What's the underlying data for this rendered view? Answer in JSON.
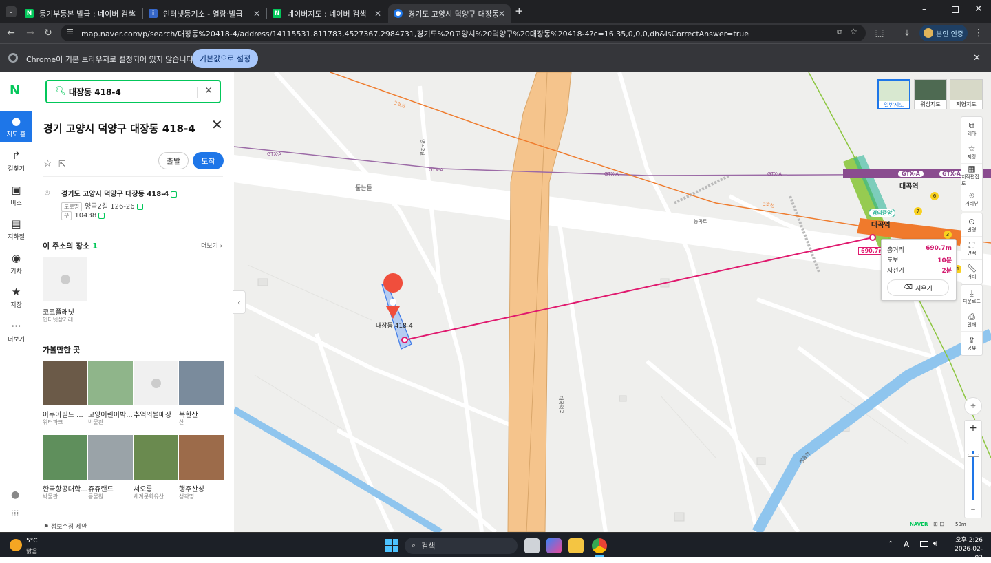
{
  "browser": {
    "tabs": [
      {
        "title": "등기부등본 발급 : 네이버 검색",
        "icon_color": "#03c75a",
        "icon_char": "N"
      },
      {
        "title": "인터넷등기소 - 열람·발급",
        "icon_color": "#3566c8",
        "icon_char": "i"
      },
      {
        "title": "네이버지도 : 네이버 검색",
        "icon_color": "#03c75a",
        "icon_char": "N"
      },
      {
        "title": "경기도 고양시 덕양구 대장동 4",
        "icon_color": "#1e76e8",
        "icon_char": "●"
      }
    ],
    "url": "map.naver.com/p/search/대장동%20418-4/address/14115531.811783,4527367.2984731,경기도%20고양시%20덕양구%20대장동%20418-4?c=16.35,0,0,0,dh&isCorrectAnswer=true",
    "profile_label": "본인 인증",
    "infobar_text": "Chrome이 기본 브라우저로 설정되어 있지 않습니다",
    "infobar_button": "기본값으로 설정"
  },
  "rail": {
    "logo": "N",
    "items": [
      {
        "label": "지도 홈",
        "icon": "map-pin-icon",
        "glyph": "●"
      },
      {
        "label": "길찾기",
        "icon": "route-icon",
        "glyph": "↱"
      },
      {
        "label": "버스",
        "icon": "bus-icon",
        "glyph": "▣"
      },
      {
        "label": "지하철",
        "icon": "subway-icon",
        "glyph": "▤"
      },
      {
        "label": "기차",
        "icon": "train-icon",
        "glyph": "◉"
      },
      {
        "label": "저장",
        "icon": "star-icon",
        "glyph": "★"
      },
      {
        "label": "더보기",
        "icon": "more-icon",
        "glyph": "···"
      }
    ]
  },
  "panel": {
    "search_value": "대장동 418-4",
    "title": "경기 고양시 덕양구 대장동 418-4",
    "depart_label": "출발",
    "arrive_label": "도착",
    "address": "경기도 고양시 덕양구 대장동 418-4",
    "road_tag": "도로명",
    "road_address": "양곡2길 126-26",
    "zip_tag": "우",
    "zip": "10438",
    "places_title": "이 주소의 장소",
    "places_count": "1",
    "more_label": "더보기",
    "place": {
      "name": "코코플래닛",
      "category": "인터넷상거래"
    },
    "nearby_title": "가볼만한 곳",
    "nearby": [
      {
        "name": "아쿠아필드 ...",
        "category": "워터파크",
        "color": "#6b5a48"
      },
      {
        "name": "고양어린이박...",
        "category": "박물관",
        "color": "#8fb58a"
      },
      {
        "name": "추억의썰매장",
        "category": "",
        "color": "#f0f0f0"
      },
      {
        "name": "북한산",
        "category": "산",
        "color": "#7a8b9c"
      },
      {
        "name": "한국항공대학...",
        "category": "박물관",
        "color": "#5f8f5c"
      },
      {
        "name": "쥬쥬랜드",
        "category": "동물원",
        "color": "#9aa3a8"
      },
      {
        "name": "서오릉",
        "category": "세계문화유산",
        "color": "#6a8a4f"
      },
      {
        "name": "행주산성",
        "category": "성곽명",
        "color": "#9c6b4a"
      }
    ],
    "edit_suggest": "정보수정 제안"
  },
  "map": {
    "labels": {
      "place": "풀는들",
      "pin": "대장동 418-4",
      "gtx": "GTX-A",
      "line3": "3호선",
      "station": "대곡역",
      "gyeongui": "경의중앙",
      "road1": "양곡2길",
      "road2": "능곡로",
      "road3": "대곡역로",
      "road4": "창릉천"
    },
    "map_types": [
      "일반지도",
      "위성지도",
      "지형지도"
    ],
    "controls": [
      "테마",
      "저장",
      "지적편집도",
      "거리뷰",
      "반경",
      "면적",
      "거리",
      "다운로드",
      "인쇄",
      "공유"
    ],
    "distance_popup": {
      "total_label": "총거리",
      "total_value": "690.7m",
      "walk_label": "도보",
      "walk_value": "10분",
      "bike_label": "자전거",
      "bike_value": "2분",
      "clear_label": "지우기"
    },
    "distance_tag": "690.7m",
    "scale_label": "50m",
    "brand": "NAVER"
  },
  "taskbar": {
    "weather_temp": "5°C",
    "weather_desc": "맑음",
    "search_label": "검색",
    "time": "오후 2:26",
    "date": "2026-02-03",
    "ime": "A"
  }
}
